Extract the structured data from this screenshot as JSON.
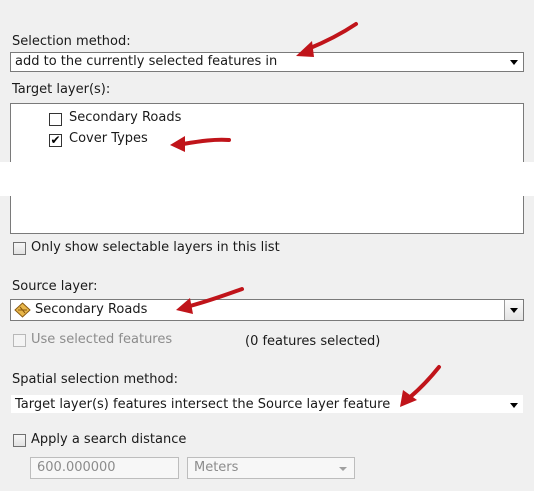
{
  "selection_method": {
    "label": "Selection method:",
    "value": "add to the currently selected features in"
  },
  "target_layers": {
    "label": "Target layer(s):",
    "items": [
      {
        "label": "Secondary Roads",
        "checked": false
      },
      {
        "label": "Cover Types",
        "checked": true
      }
    ]
  },
  "only_selectable": {
    "label": "Only show selectable layers in this list",
    "checked": false
  },
  "source_layer": {
    "label": "Source layer:",
    "value": "Secondary Roads",
    "icon": "layer-diamond-icon"
  },
  "use_selected": {
    "label": "Use selected features",
    "checked": false,
    "enabled": false,
    "count_text": "(0 features selected)"
  },
  "spatial_method": {
    "label": "Spatial selection method:",
    "value": "Target layer(s) features intersect the Source layer feature"
  },
  "search_distance": {
    "label": "Apply a search distance",
    "checked": false,
    "distance": "600.000000",
    "units": "Meters"
  },
  "colors": {
    "panel": "#f0f0f0",
    "annotation_arrow": "#c0141a",
    "layer_icon": "#e8b64a"
  }
}
